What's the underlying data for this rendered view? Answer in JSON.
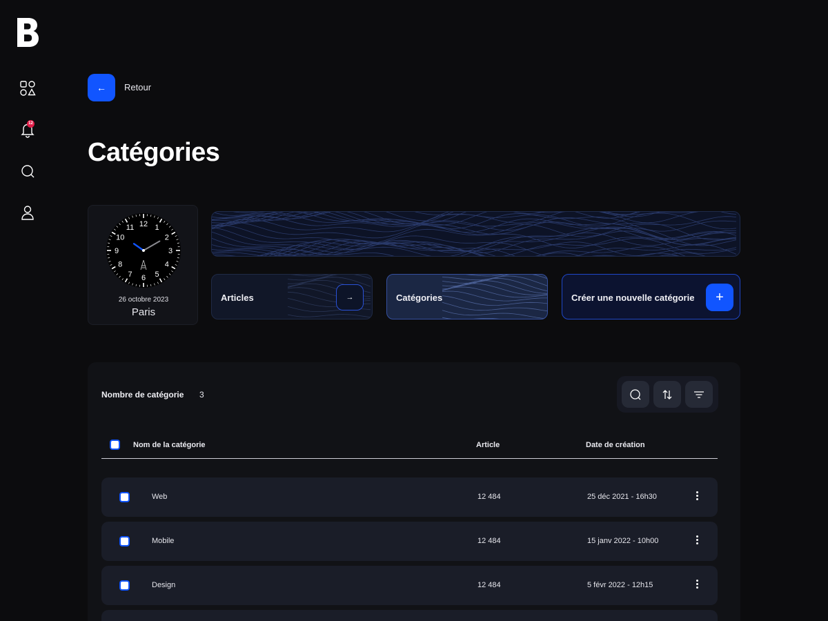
{
  "brand": {
    "logo_letter": "B"
  },
  "sidebar": {
    "items": [
      {
        "icon": "shapes-icon"
      },
      {
        "icon": "bell-icon",
        "badge": "12"
      },
      {
        "icon": "search-icon"
      },
      {
        "icon": "user-icon"
      }
    ]
  },
  "back": {
    "label": "Retour",
    "icon": "arrow-left-icon"
  },
  "page": {
    "title": "Catégories"
  },
  "clock": {
    "date": "26 octobre 2023",
    "city": "Paris",
    "hour": 10,
    "minute": 10,
    "numerals": [
      "12",
      "1",
      "2",
      "3",
      "4",
      "5",
      "6",
      "7",
      "8",
      "9",
      "10",
      "11"
    ]
  },
  "nav_cards": {
    "articles": {
      "label": "Articles",
      "icon": "arrow-right-icon"
    },
    "categories": {
      "label": "Catégories"
    },
    "create": {
      "label": "Créer une nouvelle catégorie",
      "icon": "plus-icon",
      "plus": "+"
    }
  },
  "table": {
    "count_label": "Nombre de catégorie",
    "count_value": "3",
    "tools": [
      "search-icon",
      "sort-icon",
      "filter-icon"
    ],
    "columns": {
      "name": "Nom de la catégorie",
      "articles": "Article",
      "date": "Date de création"
    },
    "rows": [
      {
        "name": "Web",
        "articles": "12 484",
        "date": "25 déc 2021 - 16h30"
      },
      {
        "name": "Mobile",
        "articles": "12 484",
        "date": "15 janv 2022 - 10h00"
      },
      {
        "name": "Design",
        "articles": "12 484",
        "date": "5 févr 2022 - 12h15"
      }
    ]
  },
  "colors": {
    "accent": "#1155ff",
    "background": "#0c0c0e",
    "badge": "#e11d48"
  }
}
